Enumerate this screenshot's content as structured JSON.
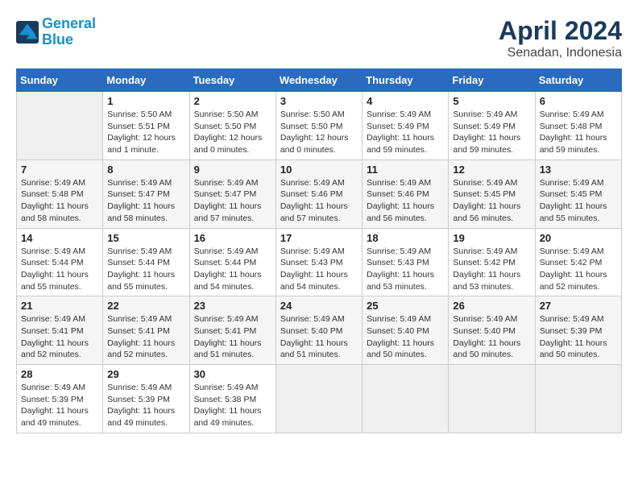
{
  "header": {
    "logo_line1": "General",
    "logo_line2": "Blue",
    "month_title": "April 2024",
    "subtitle": "Senadan, Indonesia"
  },
  "weekdays": [
    "Sunday",
    "Monday",
    "Tuesday",
    "Wednesday",
    "Thursday",
    "Friday",
    "Saturday"
  ],
  "weeks": [
    [
      {
        "day": "",
        "info": ""
      },
      {
        "day": "1",
        "info": "Sunrise: 5:50 AM\nSunset: 5:51 PM\nDaylight: 12 hours\nand 1 minute."
      },
      {
        "day": "2",
        "info": "Sunrise: 5:50 AM\nSunset: 5:50 PM\nDaylight: 12 hours\nand 0 minutes."
      },
      {
        "day": "3",
        "info": "Sunrise: 5:50 AM\nSunset: 5:50 PM\nDaylight: 12 hours\nand 0 minutes."
      },
      {
        "day": "4",
        "info": "Sunrise: 5:49 AM\nSunset: 5:49 PM\nDaylight: 11 hours\nand 59 minutes."
      },
      {
        "day": "5",
        "info": "Sunrise: 5:49 AM\nSunset: 5:49 PM\nDaylight: 11 hours\nand 59 minutes."
      },
      {
        "day": "6",
        "info": "Sunrise: 5:49 AM\nSunset: 5:48 PM\nDaylight: 11 hours\nand 59 minutes."
      }
    ],
    [
      {
        "day": "7",
        "info": "Sunrise: 5:49 AM\nSunset: 5:48 PM\nDaylight: 11 hours\nand 58 minutes."
      },
      {
        "day": "8",
        "info": "Sunrise: 5:49 AM\nSunset: 5:47 PM\nDaylight: 11 hours\nand 58 minutes."
      },
      {
        "day": "9",
        "info": "Sunrise: 5:49 AM\nSunset: 5:47 PM\nDaylight: 11 hours\nand 57 minutes."
      },
      {
        "day": "10",
        "info": "Sunrise: 5:49 AM\nSunset: 5:46 PM\nDaylight: 11 hours\nand 57 minutes."
      },
      {
        "day": "11",
        "info": "Sunrise: 5:49 AM\nSunset: 5:46 PM\nDaylight: 11 hours\nand 56 minutes."
      },
      {
        "day": "12",
        "info": "Sunrise: 5:49 AM\nSunset: 5:45 PM\nDaylight: 11 hours\nand 56 minutes."
      },
      {
        "day": "13",
        "info": "Sunrise: 5:49 AM\nSunset: 5:45 PM\nDaylight: 11 hours\nand 55 minutes."
      }
    ],
    [
      {
        "day": "14",
        "info": "Sunrise: 5:49 AM\nSunset: 5:44 PM\nDaylight: 11 hours\nand 55 minutes."
      },
      {
        "day": "15",
        "info": "Sunrise: 5:49 AM\nSunset: 5:44 PM\nDaylight: 11 hours\nand 55 minutes."
      },
      {
        "day": "16",
        "info": "Sunrise: 5:49 AM\nSunset: 5:44 PM\nDaylight: 11 hours\nand 54 minutes."
      },
      {
        "day": "17",
        "info": "Sunrise: 5:49 AM\nSunset: 5:43 PM\nDaylight: 11 hours\nand 54 minutes."
      },
      {
        "day": "18",
        "info": "Sunrise: 5:49 AM\nSunset: 5:43 PM\nDaylight: 11 hours\nand 53 minutes."
      },
      {
        "day": "19",
        "info": "Sunrise: 5:49 AM\nSunset: 5:42 PM\nDaylight: 11 hours\nand 53 minutes."
      },
      {
        "day": "20",
        "info": "Sunrise: 5:49 AM\nSunset: 5:42 PM\nDaylight: 11 hours\nand 52 minutes."
      }
    ],
    [
      {
        "day": "21",
        "info": "Sunrise: 5:49 AM\nSunset: 5:41 PM\nDaylight: 11 hours\nand 52 minutes."
      },
      {
        "day": "22",
        "info": "Sunrise: 5:49 AM\nSunset: 5:41 PM\nDaylight: 11 hours\nand 52 minutes."
      },
      {
        "day": "23",
        "info": "Sunrise: 5:49 AM\nSunset: 5:41 PM\nDaylight: 11 hours\nand 51 minutes."
      },
      {
        "day": "24",
        "info": "Sunrise: 5:49 AM\nSunset: 5:40 PM\nDaylight: 11 hours\nand 51 minutes."
      },
      {
        "day": "25",
        "info": "Sunrise: 5:49 AM\nSunset: 5:40 PM\nDaylight: 11 hours\nand 50 minutes."
      },
      {
        "day": "26",
        "info": "Sunrise: 5:49 AM\nSunset: 5:40 PM\nDaylight: 11 hours\nand 50 minutes."
      },
      {
        "day": "27",
        "info": "Sunrise: 5:49 AM\nSunset: 5:39 PM\nDaylight: 11 hours\nand 50 minutes."
      }
    ],
    [
      {
        "day": "28",
        "info": "Sunrise: 5:49 AM\nSunset: 5:39 PM\nDaylight: 11 hours\nand 49 minutes."
      },
      {
        "day": "29",
        "info": "Sunrise: 5:49 AM\nSunset: 5:39 PM\nDaylight: 11 hours\nand 49 minutes."
      },
      {
        "day": "30",
        "info": "Sunrise: 5:49 AM\nSunset: 5:38 PM\nDaylight: 11 hours\nand 49 minutes."
      },
      {
        "day": "",
        "info": ""
      },
      {
        "day": "",
        "info": ""
      },
      {
        "day": "",
        "info": ""
      },
      {
        "day": "",
        "info": ""
      }
    ]
  ]
}
